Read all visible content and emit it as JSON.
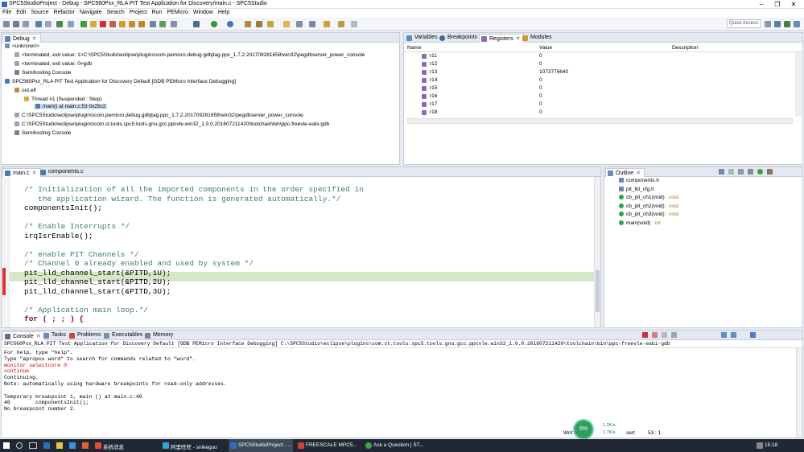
{
  "window": {
    "title": "SPC5StudioProject - Debug - SPC560Pxx_RLA PIT Test Application for Discovery/main.c - SPC5Studio"
  },
  "menu": [
    "File",
    "Edit",
    "Source",
    "Refactor",
    "Navigate",
    "Search",
    "Project",
    "Run",
    "PEMicro",
    "Window",
    "Help"
  ],
  "toolbar": {
    "quick_access": "Quick Access"
  },
  "debug": {
    "tab": "Debug",
    "tree": [
      "<unknown>",
      "<terminated, exit value: 1>C:\\SPC5Studio\\eclipse\\plugins\\com.pemicro.debug.gdbjtag.ppc_1.7.2.201709281658\\win32\\pegdbserver_power_console",
      "<terminated, exit value: 0>gdb",
      "Semihosting Console",
      "SPC560Pxx_RLA PIT Test Application for Discovery Default [GDB PEMicro Interface Debugging]",
      "out.elf",
      "Thread #1 (Suspended : Step)",
      "main() at main.c:53 0x25c2",
      "C:\\SPC5Studio\\eclipse\\plugins\\com.pemicro.debug.gdbjtag.ppc_1.7.2.201709281658\\win32\\pegdbserver_power_console",
      "C:\\SPC5Studio\\eclipse\\plugins\\com.st.tools.spc5.tools.gnu.gcc.ppcvle.win32_1.0.0.201607211420\\toolchain\\bin\\ppc-freevle-eabi-gdb",
      "Semihosting Console"
    ]
  },
  "registers": {
    "tabs": [
      "Variables",
      "Breakpoints",
      "Registers",
      "Modules"
    ],
    "columns": [
      "Name",
      "Value",
      "Description"
    ],
    "rows": [
      {
        "name": "r11",
        "value": "0"
      },
      {
        "name": "r12",
        "value": "0"
      },
      {
        "name": "r13",
        "value": "1073776640"
      },
      {
        "name": "r14",
        "value": "0"
      },
      {
        "name": "r15",
        "value": "0"
      },
      {
        "name": "r16",
        "value": "0"
      },
      {
        "name": "r17",
        "value": "0"
      },
      {
        "name": "r18",
        "value": "0"
      }
    ]
  },
  "editor": {
    "tabs": [
      "main.c",
      "components.c"
    ],
    "lines": [
      "/* Initialization of all the imported components in the order specified in",
      "   the application wizard. The function is generated automatically.*/",
      "componentsInit();",
      "",
      "/* Enable Interrupts */",
      "irqIsrEnable();",
      "",
      "/* enable PIT Channels */",
      "/* Channel 0 already enabled and used by system */",
      "pit_lld_channel_start(&PITD,1U);",
      "pit_lld_channel_start(&PITD,2U);",
      "pit_lld_channel_start(&PITD,3U);",
      "",
      "/* Application main loop.*/",
      "for ( ; ; ) {"
    ]
  },
  "outline": {
    "tab": "Outline",
    "items": [
      {
        "name": "components.h",
        "type": ""
      },
      {
        "name": "pit_lld_cfg.h",
        "type": ""
      },
      {
        "name": "cb_pit_ch1(void)",
        "type": " : void"
      },
      {
        "name": "cb_pit_ch2(void)",
        "type": " : void"
      },
      {
        "name": "cb_pit_ch3(void)",
        "type": " : void"
      },
      {
        "name": "main(void)",
        "type": " : int"
      }
    ]
  },
  "console": {
    "tabs": [
      "Console",
      "Tasks",
      "Problems",
      "Executables",
      "Memory"
    ],
    "header": "SPC560Pxx_RLA PIT Test Application for Discovery Default [GDB PEMicro Interface Debugging] C:\\SPC5Studio\\eclipse\\plugins\\com.st.tools.spc5.tools.gnu.gcc.ppcvle.win32_1.0.0.201607211420\\toolchain\\bin\\ppc-freevle-eabi-gdb",
    "lines": [
      {
        "text": "For help, type \"help\".",
        "color": "#000000"
      },
      {
        "text": "Type \"apropos word\" to search for commands related to \"word\".",
        "color": "#000000"
      },
      {
        "text": "monitor selectcore 0",
        "color": "#c00000"
      },
      {
        "text": "continue",
        "color": "#c00000"
      },
      {
        "text": "Continuing.",
        "color": "#000000"
      },
      {
        "text": "Note: automatically using hardware breakpoints for read-only addresses.",
        "color": "#000000"
      },
      {
        "text": "",
        "color": "#000000"
      },
      {
        "text": "Temporary breakpoint 1, main () at main.c:46",
        "color": "#000000"
      },
      {
        "text": "46        componentsInit();",
        "color": "#000000"
      },
      {
        "text": "No breakpoint number 2.",
        "color": "#000000"
      }
    ]
  },
  "status": {
    "cpu": "5%",
    "net_up": "1.2K/s",
    "net_down": "1.7K/s",
    "write": "Writ",
    "insert": "sert",
    "position": "53 : 1"
  },
  "taskbar": {
    "items": [
      "系统消息",
      "阿里旺旺 - snikeguo",
      "SPC5StudioProject - ...",
      "FREESCALE   MPC5...",
      "Ask a Question | ST..."
    ],
    "clock": "15:18"
  },
  "colors": {
    "accent": "#2a6ebd",
    "highlight": "#d4e8c8",
    "comment": "#3f7f5f"
  }
}
